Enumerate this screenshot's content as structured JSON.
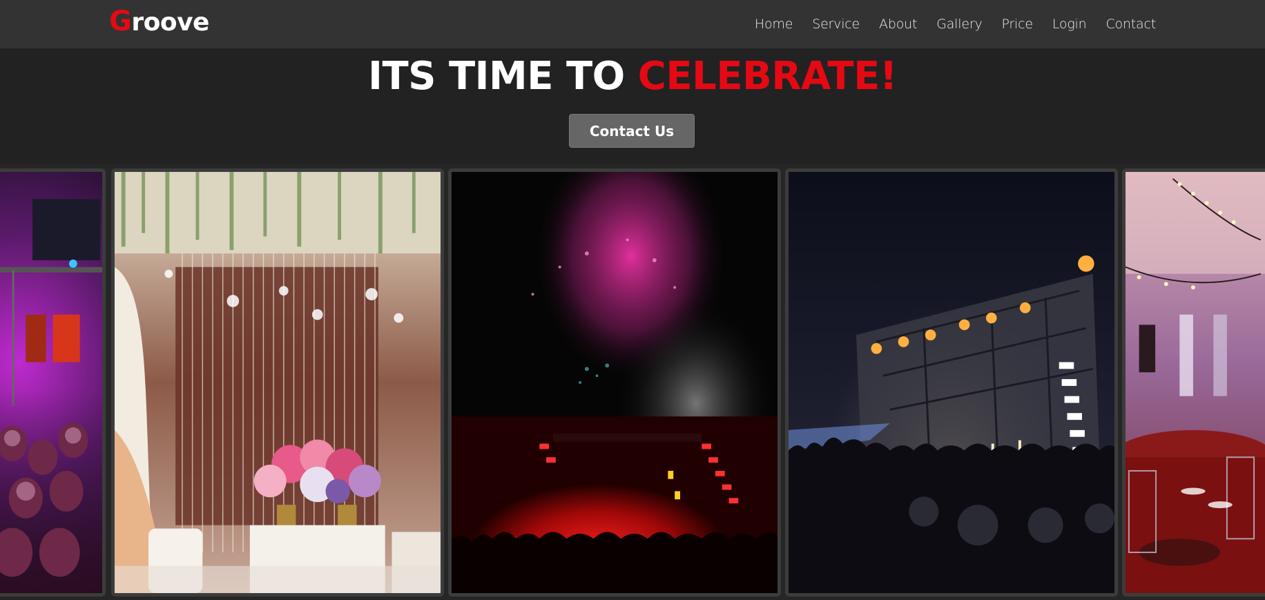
{
  "nav": {
    "logo_initial": "G",
    "logo_rest": "roove",
    "links": [
      "Home",
      "Service",
      "About",
      "Gallery",
      "Price",
      "Login",
      "Contact"
    ]
  },
  "hero": {
    "title_main": "ITS TIME TO",
    "title_accent": "CELEBRATE!",
    "cta_label": "Contact Us"
  },
  "gallery": {
    "images": [
      "concert-crowd-purple-lights",
      "wedding-stage-chandeliers-flowers",
      "fireworks-red-stage-concert",
      "concert-stage-pyrotechnics-crowd",
      "banquet-hall-dining-tables"
    ]
  },
  "colors": {
    "accent": "#e50914",
    "navbar_bg": "#333333",
    "page_bg": "#222222",
    "button_bg": "#666666"
  }
}
